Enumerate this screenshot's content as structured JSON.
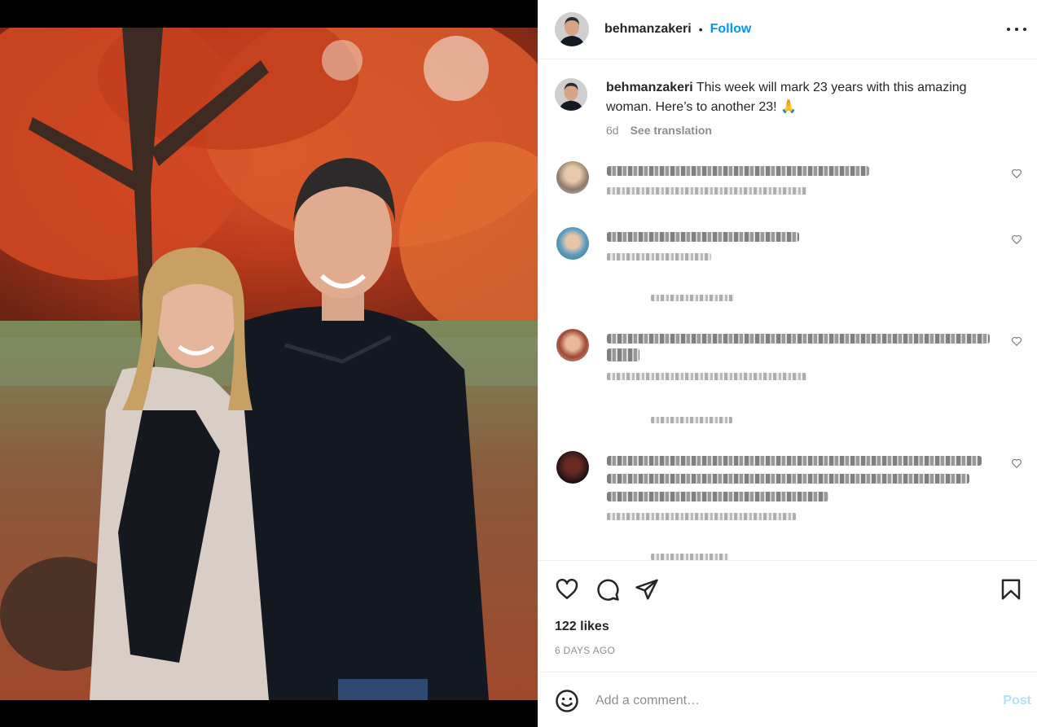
{
  "post": {
    "username": "behmanzakeri",
    "follow_label": "Follow",
    "separator": "•"
  },
  "caption": {
    "username": "behmanzakeri",
    "text": " This week will mark 23 years with this amazing woman. Here’s to another 23! 🙏",
    "age": "6d",
    "see_translation": "See translation"
  },
  "actions": {
    "like_icon": "heart-icon",
    "comment_icon": "comment-icon",
    "share_icon": "paper-plane-icon",
    "save_icon": "bookmark-icon"
  },
  "likes": "122 likes",
  "posted_ago": "6 DAYS AGO",
  "add_comment": {
    "placeholder": "Add a comment…",
    "post_label": "Post",
    "emoji_icon": "smiley-icon"
  },
  "colors": {
    "link_blue": "#0095f6",
    "post_disabled": "#b2dffc",
    "secondary_text": "#8e8e8e",
    "divider": "#efefef"
  }
}
